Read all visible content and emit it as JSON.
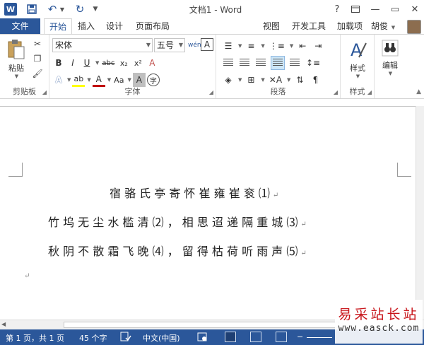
{
  "window": {
    "app_logo": "W",
    "title": "文档1 - Word",
    "help": "?",
    "minimize": "—",
    "restore": "▭",
    "close": "✕"
  },
  "tabs": {
    "file": "文件",
    "home": "开始",
    "insert": "插入",
    "design": "设计",
    "layout": "页面布局",
    "view": "视图",
    "developer": "开发工具",
    "addins": "加载项",
    "user": "胡俊"
  },
  "ribbon": {
    "clipboard": {
      "paste": "粘贴",
      "label": "剪贴板"
    },
    "font": {
      "font_name": "宋体",
      "font_size": "五号",
      "phonetic": "wén",
      "char_border": "A",
      "grow": "A",
      "shrink": "A",
      "case": "Aa",
      "clear": "A",
      "bold": "B",
      "italic": "I",
      "underline": "U",
      "strike": "abc",
      "subscript": "x₂",
      "superscript": "x²",
      "text_effect": "A",
      "highlight": "ab",
      "font_color": "A",
      "char_shading": "A",
      "enclose": "字",
      "label": "字体"
    },
    "paragraph": {
      "label": "段落"
    },
    "styles": {
      "button": "样式",
      "label": "样式"
    },
    "editing": {
      "button": "编辑"
    }
  },
  "document": {
    "lines": [
      "宿 骆 氏 亭 寄 怀 崔 雍 崔 衮 ⑴",
      "竹 坞 无 尘 水 槛 清 ⑵ ， 相 思 迢 递 隔 重 城 ⑶",
      "秋 阴 不 散 霜 飞 晚 ⑷ ， 留 得 枯 荷 听 雨 声 ⑸"
    ],
    "para_mark": "↵"
  },
  "status": {
    "page": "第 1 页，共 1 页",
    "words": "45 个字",
    "language": "中文(中国)"
  },
  "watermark": {
    "title": "易采站长站",
    "url": "www.easck.com"
  },
  "colors": {
    "accent": "#2b579a",
    "watermark": "#c8141a"
  }
}
